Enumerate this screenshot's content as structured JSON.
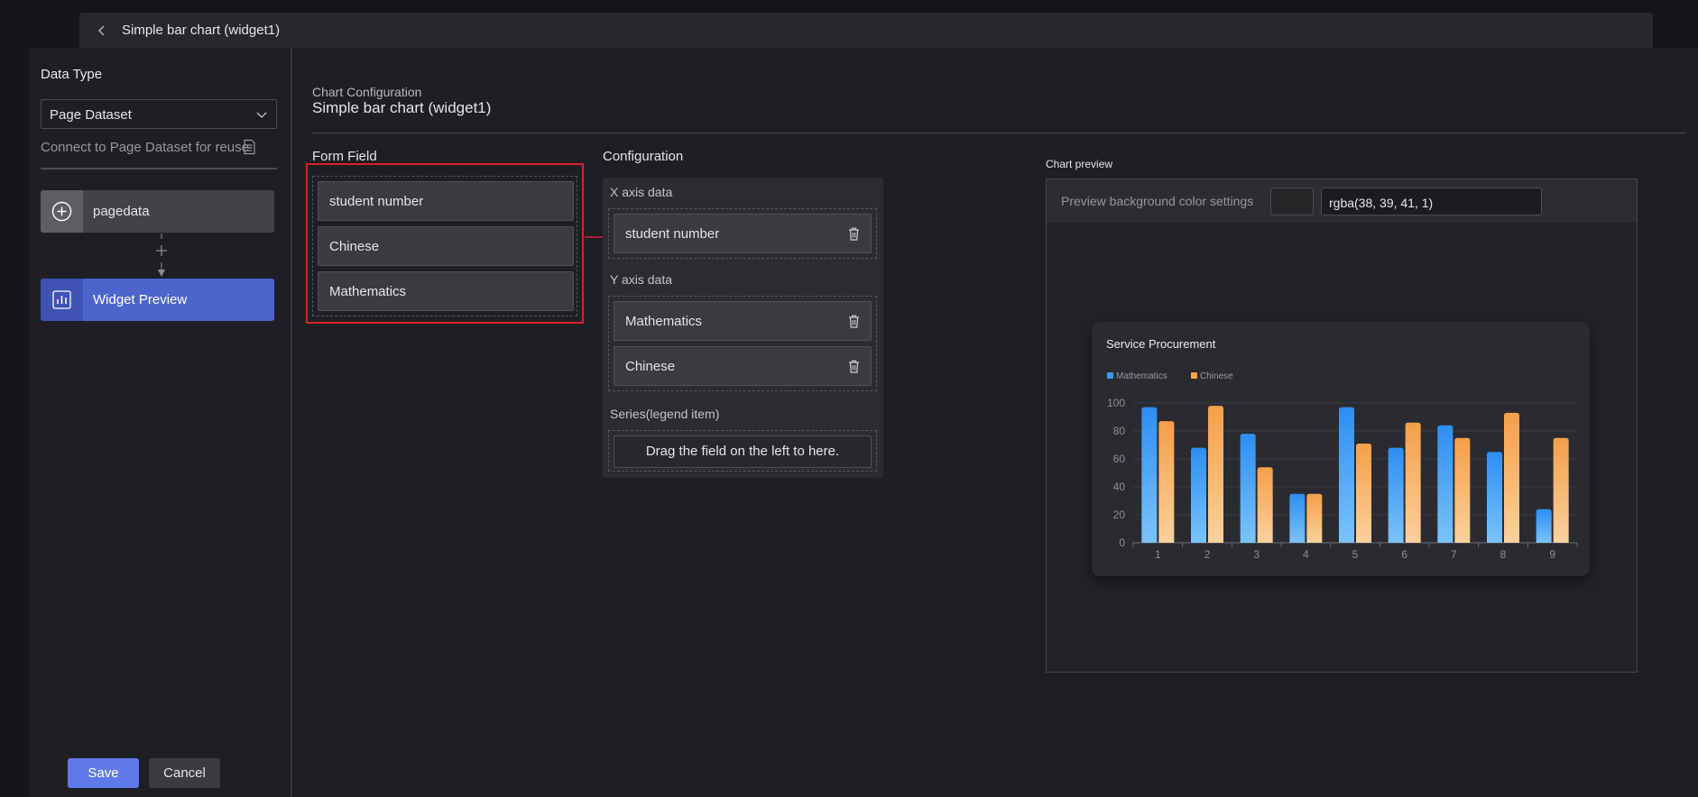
{
  "topbar": {
    "title": "Simple bar chart (widget1)"
  },
  "sidebar": {
    "data_type_label": "Data Type",
    "dataset_select_value": "Page Dataset",
    "reuse_hint": "Connect to Page Dataset for reuse.",
    "nodes": [
      {
        "label": "pagedata",
        "icon": "plus-circle-icon"
      },
      {
        "label": "Widget Preview",
        "icon": "chart-icon"
      }
    ],
    "save_label": "Save",
    "cancel_label": "Cancel"
  },
  "header": {
    "heading": "Chart Configuration",
    "title": "Simple bar chart (widget1)"
  },
  "form_field": {
    "label": "Form Field",
    "items": [
      "student number",
      "Chinese",
      "Mathematics"
    ],
    "highlight_color": "#d9202a"
  },
  "configuration": {
    "label": "Configuration",
    "x_axis_label": "X axis data",
    "x_axis_items": [
      "student number"
    ],
    "y_axis_label": "Y axis data",
    "y_axis_items": [
      "Mathematics",
      "Chinese"
    ],
    "series_label": "Series(legend item)",
    "series_placeholder": "Drag the field on the left to here."
  },
  "preview": {
    "label": "Chart preview",
    "bg_settings_label": "Preview background color settings",
    "bg_color_value": "rgba(38, 39, 41, 1)"
  },
  "chart_data": {
    "type": "bar",
    "title": "Service Procurement",
    "categories": [
      "1",
      "2",
      "3",
      "4",
      "5",
      "6",
      "7",
      "8",
      "9"
    ],
    "series": [
      {
        "name": "Mathematics",
        "values": [
          97,
          68,
          78,
          35,
          97,
          68,
          84,
          65,
          24
        ],
        "color": "#3a9bf5"
      },
      {
        "name": "Chinese",
        "values": [
          87,
          98,
          54,
          35,
          71,
          86,
          75,
          93,
          75
        ],
        "color": "#f5a453"
      }
    ],
    "yticks": [
      0,
      20,
      40,
      60,
      80,
      100
    ],
    "ylim": [
      0,
      100
    ],
    "legend_position": "top-left",
    "grid": true
  }
}
